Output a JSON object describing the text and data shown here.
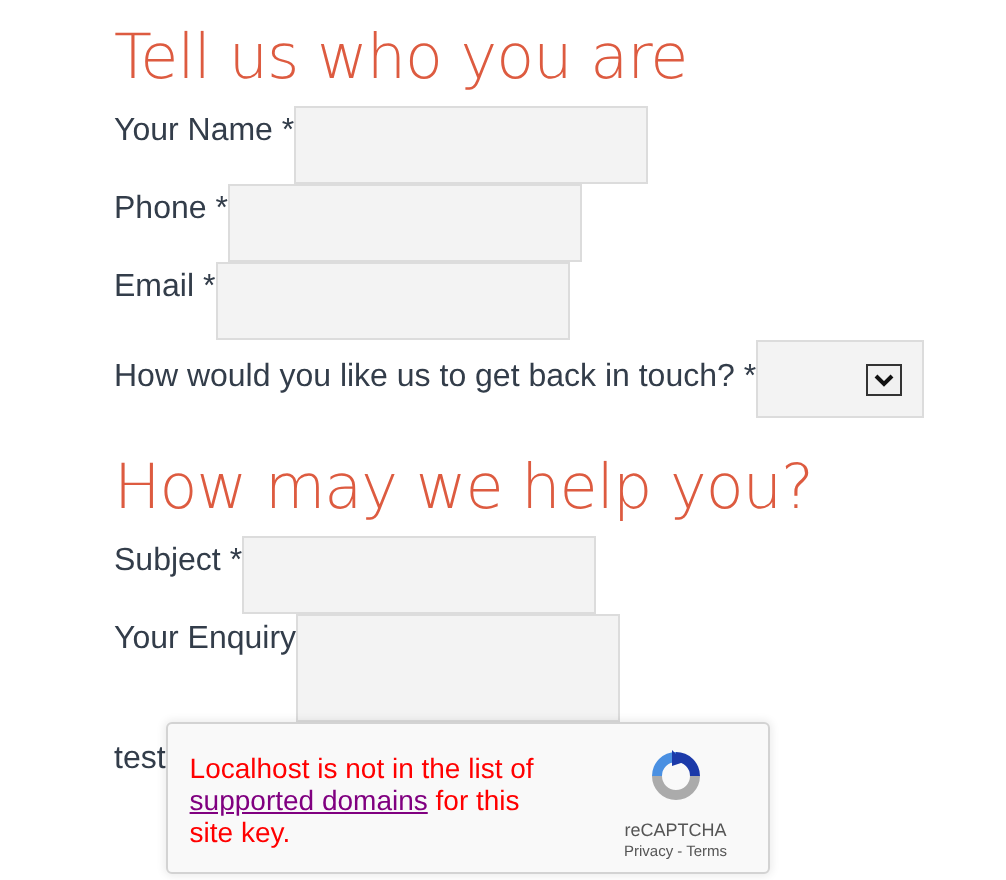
{
  "sections": [
    {
      "title": "Tell us who you are",
      "fields": [
        {
          "label": "Your Name *",
          "kind": "text"
        },
        {
          "label": "Phone *",
          "kind": "text"
        },
        {
          "label": "Email *",
          "kind": "text"
        },
        {
          "label": "How would you like us to get back in touch? *",
          "kind": "select"
        }
      ]
    },
    {
      "title": "How may we help you?",
      "fields": [
        {
          "label": "Subject *",
          "kind": "text"
        },
        {
          "label": "Your Enquiry",
          "kind": "textarea"
        },
        {
          "label": "test",
          "kind": "captcha"
        }
      ]
    }
  ],
  "captcha": {
    "message_before": "Localhost is not in the list of",
    "link": "supported domains",
    "message_after": "for this site key.",
    "brand": "reCAPTCHA",
    "links": "Privacy - Terms"
  }
}
